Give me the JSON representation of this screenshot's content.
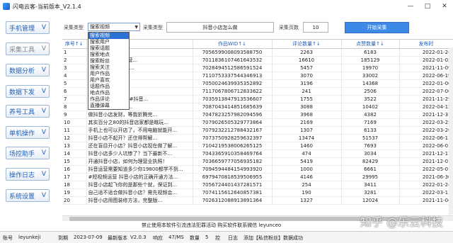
{
  "window": {
    "title": "闪电云客-当前版本_V2.1.4",
    "minimize": "—",
    "maximize": "□",
    "close": "✕"
  },
  "sidebar": {
    "items": [
      {
        "label": "手机管理",
        "chev": "V"
      },
      {
        "label": "采集工具",
        "chev": "V",
        "active": true
      },
      {
        "label": "数据分析",
        "chev": "V"
      },
      {
        "label": "数据下发",
        "chev": "V"
      },
      {
        "label": "养号工具",
        "chev": "V"
      },
      {
        "label": "单机操作",
        "chev": "V"
      },
      {
        "label": "场控助手",
        "chev": "V"
      },
      {
        "label": "操作日志",
        "chev": "V"
      },
      {
        "label": "系统设置",
        "chev": "V"
      }
    ]
  },
  "toolbar": {
    "type_label": "采集类型",
    "type_value": "搜索视频",
    "sub_type_label": "采集类型",
    "keyword_value": "抖音小店怎么做",
    "pages_label": "采集页数",
    "pages_value": "10",
    "start_label": "开始采集"
  },
  "dropdown": {
    "options": [
      "搜索视频",
      "搜索用户",
      "搜索话题",
      "搜索地点",
      "搜索粉丝",
      "搜索关注",
      "用户作品",
      "用户喜欢",
      "话题作品",
      "地点作品",
      "作品评论",
      "直播弹幕"
    ],
    "selected": 0
  },
  "table": {
    "headers": [
      "序号↑↓",
      "",
      "作品WID↑↓",
      "评论数量↑↓",
      "点赞数量↑↓",
      "发布时"
    ],
    "rows": [
      [
        "1",
        "抖音小店 #短视频",
        "7056599008093588750",
        "2263",
        "6183",
        "2022-01-24"
      ],
      [
        "2",
        "无货源抖音小店运营...",
        "7011836107461643532",
        "16610",
        "185129",
        "2022-01-02"
      ],
      [
        "3",
        "抖音小店 两分钟教...",
        "7028494512586591524",
        "5457",
        "19970",
        "2021-11-09"
      ],
      [
        "4",
        "#知识分享 准备...",
        "7110753337544346913",
        "3070",
        "33002",
        "2022-06-19"
      ],
      [
        "5",
        "卖货7万块 抖音...",
        "7050024639935352892",
        "3196",
        "14368",
        "2022-01-06"
      ],
      [
        "6",
        "亏了，现场开店...",
        "7117067806712833622",
        "241",
        "2506",
        "2022-07-06"
      ],
      [
        "7",
        "#抖音小店 #创业 #抖音...",
        "7035913847913536607",
        "1755",
        "3522",
        "2021-11-29"
      ],
      [
        "8",
        "大盘第二千货分享...",
        "7087043414851685639",
        "3088",
        "10402",
        "2022-04-15"
      ],
      [
        "9",
        "做抖音小店发财，等我折腾完...",
        "7047823257982094596",
        "3968",
        "4382",
        "2021-12-31"
      ],
      [
        "10",
        "其实百分之80的抖音店家都是瞎玩...",
        "7079026505329773864",
        "2169",
        "7169",
        "2022-03-25"
      ],
      [
        "11",
        "手机上也可以开店了，不用电脑就能开...",
        "7079232212788432167",
        "1307",
        "6133",
        "2022-03-26"
      ],
      [
        "12",
        "抖音小店不起开？还住得帮解...",
        "7073750928259632397",
        "13474",
        "51537",
        "2022-06-11"
      ],
      [
        "13",
        "还在盲目开小店？抖音小店现在做了解...",
        "7104219538006265125",
        "1460",
        "7693",
        "2022-06-01"
      ],
      [
        "14",
        "抖音小店多少人坑惨了？当下最新不...",
        "7043365910358469764",
        "474",
        "3034",
        "2021-12-17"
      ],
      [
        "15",
        "开通抖音小店，如何为理营业执照！",
        "7036659777056935182",
        "5419",
        "82429",
        "2021-12-01"
      ],
      [
        "16",
        "抖音运营需要知道多少你19800都学不到...",
        "7094594484154993920",
        "1000",
        "6661",
        "2022-05-07"
      ],
      [
        "17",
        "#短视频运营 抖音小店的正确开通方法...",
        "6979470818539506955",
        "4146",
        "29995",
        "2021-06-30"
      ],
      [
        "18",
        "抖音小店起飞你的是那些个就，保证到...",
        "7056724401437281571",
        "254",
        "3411",
        "2022-01-24"
      ],
      [
        "19",
        "自己适不适合做抖音小店？需先视频会...",
        "7074115612640857381",
        "190",
        "3281",
        "2022-03-11"
      ],
      [
        "20",
        "抖音小店用图装修方法，完整版...",
        "7026312088913891364",
        "1327",
        "12024",
        "2021-11-04"
      ]
    ]
  },
  "notice": "禁止使用本软件引流违法犯罪活动  购买软件联系微信 leyunceo",
  "watermark": "知乎 @乐云科技",
  "status": {
    "account_label": "账号",
    "account": "leyunkeji",
    "expire_label": "到期",
    "expire": "2023-07-09",
    "version_label": "最新版本",
    "version": "V2.0.3",
    "latency_label": "响应",
    "latency": "47/MS",
    "devices_label": "数量",
    "devices": "5",
    "check": "控",
    "log_label": "日志",
    "log": "添加【私信粉丝】数据成功"
  }
}
